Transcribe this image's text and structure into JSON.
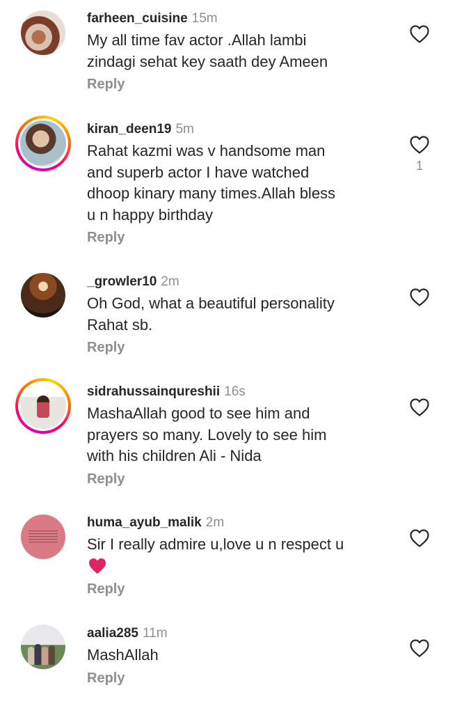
{
  "comments": [
    {
      "username": "farheen_cuisine",
      "time": "15m",
      "text": "My all time fav actor .Allah lambi\nzindagi sehat key saath dey Ameen",
      "reply_label": "Reply",
      "likes": "",
      "avatar": "food-photo",
      "story_ring": false
    },
    {
      "username": "kiran_deen19",
      "time": "5m",
      "text": "Rahat kazmi was v handsome man\nand superb actor I have watched\ndhoop kinary many times.Allah bless\nu n happy birthday",
      "reply_label": "Reply",
      "likes": "1",
      "avatar": "woman-portrait",
      "story_ring": true
    },
    {
      "username": "_growler10",
      "time": "2m",
      "text": "Oh God, what a beautiful personality\nRahat sb.",
      "reply_label": "Reply",
      "likes": "",
      "avatar": "autumn-forest",
      "story_ring": false
    },
    {
      "username": "sidrahussainqureshii",
      "time": "16s",
      "text": "MashaAllah good to see him and\nprayers so many. Lovely to see him\nwith his children Ali - Nida",
      "reply_label": "Reply",
      "likes": "",
      "avatar": "woman-standing",
      "story_ring": true
    },
    {
      "username": "huma_ayub_malik",
      "time": "2m",
      "text": "Sir I really admire u,love u n respect u",
      "reply_label": "Reply",
      "likes": "",
      "avatar": "pink-quote-card",
      "story_ring": false,
      "emoji": "red-heart"
    },
    {
      "username": "aalia285",
      "time": "11m",
      "text": "MashAllah",
      "reply_label": "Reply",
      "likes": "",
      "avatar": "family-group",
      "story_ring": false
    }
  ],
  "colors": {
    "text": "#262626",
    "secondary": "#8e8e8e",
    "heart_red": "#e0245e",
    "story_ring": [
      "#d300c5",
      "#ff0069",
      "#ff7a00",
      "#ffd600"
    ]
  }
}
